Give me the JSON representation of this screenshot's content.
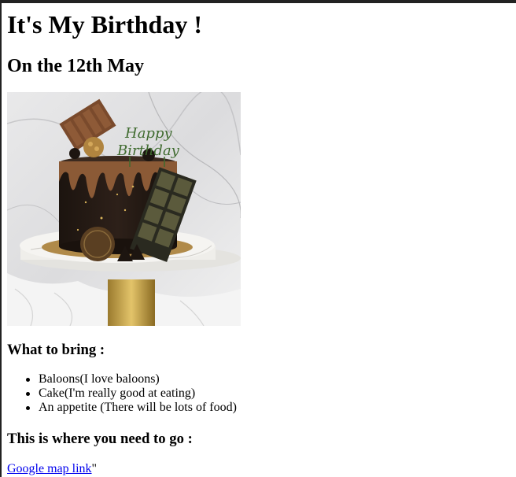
{
  "page": {
    "title": "It's My Birthday !",
    "subtitle": "On the 12th May"
  },
  "image": {
    "icon": "birthday-cake-photo",
    "topper_text": "Happy Birthday"
  },
  "bring": {
    "heading": "What to bring :",
    "items": [
      {
        "label": "Baloons(I love baloons)"
      },
      {
        "label": "Cake(I'm really good at eating)"
      },
      {
        "label": "An appetite (There will be lots of food)"
      }
    ]
  },
  "location": {
    "heading": "This is where you need to go :",
    "link_label": "Google map link",
    "trailing_text": "\""
  },
  "colors": {
    "link": "#0000ee",
    "chrome": "#222222"
  }
}
